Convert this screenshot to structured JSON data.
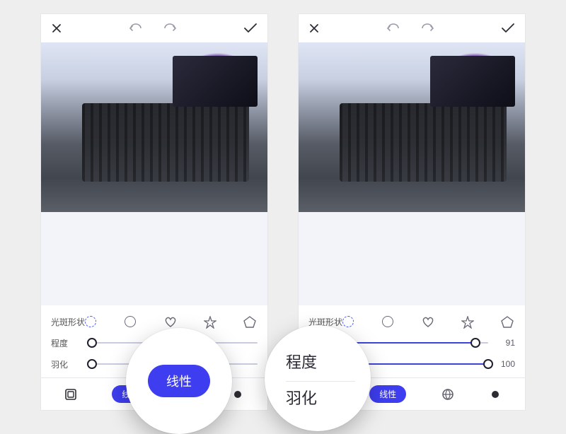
{
  "labels": {
    "shape": "光斑形状",
    "intensity": "程度",
    "feather": "羽化"
  },
  "left": {
    "tab_label": "线性",
    "intensity_value": 0,
    "feather_value": 0
  },
  "right": {
    "tab_label": "线性",
    "intensity_value": 91,
    "feather_value": 100
  },
  "zoom_left_pill": "线性",
  "zoom_right_labels": {
    "top": "程度",
    "bottom": "羽化"
  }
}
